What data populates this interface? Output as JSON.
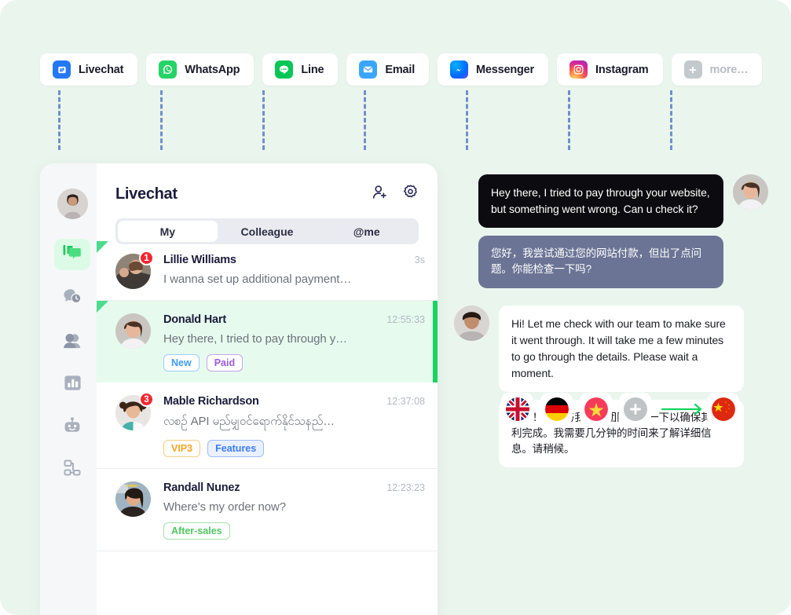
{
  "theme": {
    "page_bg": "#eaf5ee",
    "accent_green": "#17d463",
    "dash_color": "#5b7fc4",
    "badge_red": "#f6262f"
  },
  "channel_tabs": [
    {
      "label": "Livechat",
      "icon": "livechat-icon",
      "active": true
    },
    {
      "label": "WhatsApp",
      "icon": "whatsapp-icon",
      "active": false
    },
    {
      "label": "Line",
      "icon": "line-icon",
      "active": false
    },
    {
      "label": "Email",
      "icon": "email-icon",
      "active": false
    },
    {
      "label": "Messenger",
      "icon": "messenger-icon",
      "active": false
    },
    {
      "label": "Instagram",
      "icon": "instagram-icon",
      "active": false
    },
    {
      "label": "more…",
      "icon": "plus-circle-icon",
      "active": false
    }
  ],
  "rail": {
    "avatar": "user-avatar",
    "items": [
      {
        "name": "sidebar-item-chats",
        "icon": "chat-bubbles-icon",
        "active": true
      },
      {
        "name": "sidebar-item-history",
        "icon": "chat-clock-icon",
        "active": false
      },
      {
        "name": "sidebar-item-contacts",
        "icon": "contacts-icon",
        "active": false
      },
      {
        "name": "sidebar-item-analytics",
        "icon": "bar-chart-icon",
        "active": false
      },
      {
        "name": "sidebar-item-bot",
        "icon": "robot-icon",
        "active": false
      },
      {
        "name": "sidebar-item-workflow",
        "icon": "workflow-icon",
        "active": false
      }
    ]
  },
  "panel": {
    "title": "Livechat",
    "header_icons": [
      {
        "name": "add-user-icon",
        "label": "add-user"
      },
      {
        "name": "settings-icon",
        "label": "settings"
      }
    ],
    "segments": [
      {
        "label": "My",
        "active": true
      },
      {
        "label": "Colleague",
        "active": false
      },
      {
        "label": "@me",
        "active": false
      }
    ]
  },
  "conversations": [
    {
      "name": "Lillie Williams",
      "time": "3s",
      "preview": "I wanna set up additional payment…",
      "unread": "1",
      "selected": false,
      "marker": true,
      "tags": []
    },
    {
      "name": "Donald Hart",
      "time": "12:55:33",
      "preview": "Hey there, I tried to pay through y…",
      "unread": "",
      "selected": true,
      "marker": true,
      "tags": [
        {
          "label": "New",
          "style": "tag-new"
        },
        {
          "label": "Paid",
          "style": "tag-paid"
        }
      ]
    },
    {
      "name": "Mable Richardson",
      "time": "12:37:08",
      "preview": "လစဉ် API မည်မျှဝင်ရောက်နိုင်သနည်…",
      "unread": "3",
      "selected": false,
      "marker": false,
      "tags": [
        {
          "label": "VIP3",
          "style": "tag-vip"
        },
        {
          "label": "Features",
          "style": "tag-feat"
        }
      ]
    },
    {
      "name": "Randall Nunez",
      "time": "12:23:23",
      "preview": "Where’s my order now?",
      "unread": "",
      "selected": false,
      "marker": false,
      "tags": [
        {
          "label": "After-sales",
          "style": "tag-after"
        }
      ]
    }
  ],
  "chat": {
    "messages": [
      {
        "side": "right",
        "style": "dark",
        "text": "Hey there, I tried to pay through your website, but something went wrong. Can u check it?",
        "avatar": "customer-avatar"
      },
      {
        "side": "right",
        "style": "slate",
        "text": "您好，我尝试通过您的网站付款，但出了点问题。你能检查一下吗?",
        "avatar": ""
      },
      {
        "side": "left",
        "style": "white",
        "text": "Hi! Let me check with our team to make sure it went through. It will take me a few minutes to go through the details. Please wait a moment.",
        "avatar": "agent-avatar"
      },
      {
        "side": "left",
        "style": "white",
        "text": "你好！让我与我们的团队核实一下以确保其顺利完成。我需要几分钟的时间来了解详细信息。请稍候。",
        "avatar": ""
      }
    ]
  },
  "language_bar": {
    "source_flags": [
      {
        "name": "flag-uk",
        "label": "United Kingdom"
      },
      {
        "name": "flag-germany",
        "label": "Germany"
      },
      {
        "name": "flag-vietnam",
        "label": "Vietnam"
      },
      {
        "name": "add-language-button",
        "label": "add"
      }
    ],
    "arrow": "arrow-right-icon",
    "target_flag": {
      "name": "flag-china",
      "label": "China"
    }
  }
}
